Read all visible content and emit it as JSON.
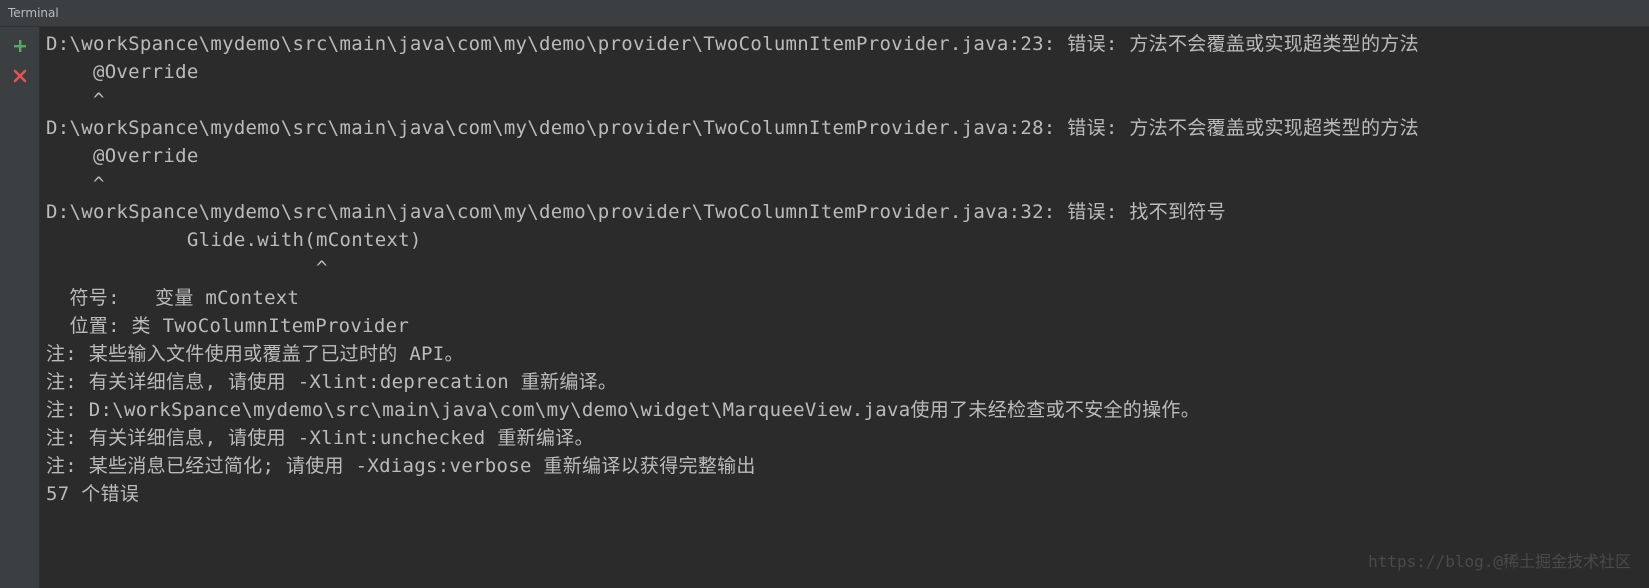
{
  "window": {
    "title": "Terminal"
  },
  "toolbar": {
    "add_icon": "plus-icon",
    "close_icon": "close-icon",
    "add_color": "#59a869",
    "close_color": "#e05555"
  },
  "terminal": {
    "lines": [
      "D:\\workSpance\\mydemo\\src\\main\\java\\com\\my\\demo\\provider\\TwoColumnItemProvider.java:23: 错误: 方法不会覆盖或实现超类型的方法",
      "    @Override",
      "    ^",
      "D:\\workSpance\\mydemo\\src\\main\\java\\com\\my\\demo\\provider\\TwoColumnItemProvider.java:28: 错误: 方法不会覆盖或实现超类型的方法",
      "    @Override",
      "    ^",
      "D:\\workSpance\\mydemo\\src\\main\\java\\com\\my\\demo\\provider\\TwoColumnItemProvider.java:32: 错误: 找不到符号",
      "            Glide.with(mContext)",
      "                       ^",
      "  符号:   变量 mContext",
      "  位置: 类 TwoColumnItemProvider",
      "注: 某些输入文件使用或覆盖了已过时的 API。",
      "注: 有关详细信息, 请使用 -Xlint:deprecation 重新编译。",
      "注: D:\\workSpance\\mydemo\\src\\main\\java\\com\\my\\demo\\widget\\MarqueeView.java使用了未经检查或不安全的操作。",
      "注: 有关详细信息, 请使用 -Xlint:unchecked 重新编译。",
      "注: 某些消息已经过简化; 请使用 -Xdiags:verbose 重新编译以获得完整输出",
      "57 个错误"
    ]
  },
  "watermark": {
    "text": "https://blog.@稀土掘金技术社区"
  }
}
